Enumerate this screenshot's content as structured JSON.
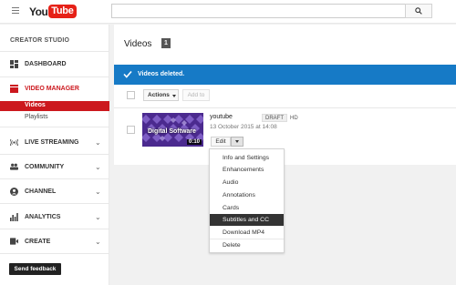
{
  "header": {
    "logo_you": "You",
    "logo_tube": "Tube",
    "search_placeholder": ""
  },
  "sidebar": {
    "studio_title": "CREATOR STUDIO",
    "items": [
      {
        "label": "DASHBOARD",
        "icon": "dashboard-icon"
      },
      {
        "label": "VIDEO MANAGER",
        "icon": "video-manager-icon",
        "active": true
      },
      {
        "label": "LIVE STREAMING",
        "icon": "live-streaming-icon"
      },
      {
        "label": "COMMUNITY",
        "icon": "community-icon"
      },
      {
        "label": "CHANNEL",
        "icon": "channel-icon"
      },
      {
        "label": "ANALYTICS",
        "icon": "analytics-icon"
      },
      {
        "label": "CREATE",
        "icon": "create-icon"
      }
    ],
    "subitems": [
      {
        "label": "Videos",
        "active": true
      },
      {
        "label": "Playlists"
      }
    ],
    "feedback_label": "Send feedback"
  },
  "main": {
    "title": "Videos",
    "count": "1",
    "notice": "Videos deleted.",
    "actions_label": "Actions",
    "addto_label": "Add to",
    "video": {
      "thumb_text": "Digital Software",
      "duration": "0:10",
      "title": "youtube",
      "status_badge": "DRAFT",
      "quality_badge": "HD",
      "date": "13 October 2015 at 14:08",
      "edit_label": "Edit"
    }
  },
  "edit_menu": {
    "items": [
      "Info and Settings",
      "Enhancements",
      "Audio",
      "Annotations",
      "Cards",
      "Subtitles and CC",
      "Download MP4",
      "Delete"
    ],
    "highlighted": "Subtitles and CC"
  },
  "colors": {
    "brand_red": "#cc181e",
    "notice_blue": "#167ac6",
    "highlight": "#333333"
  }
}
